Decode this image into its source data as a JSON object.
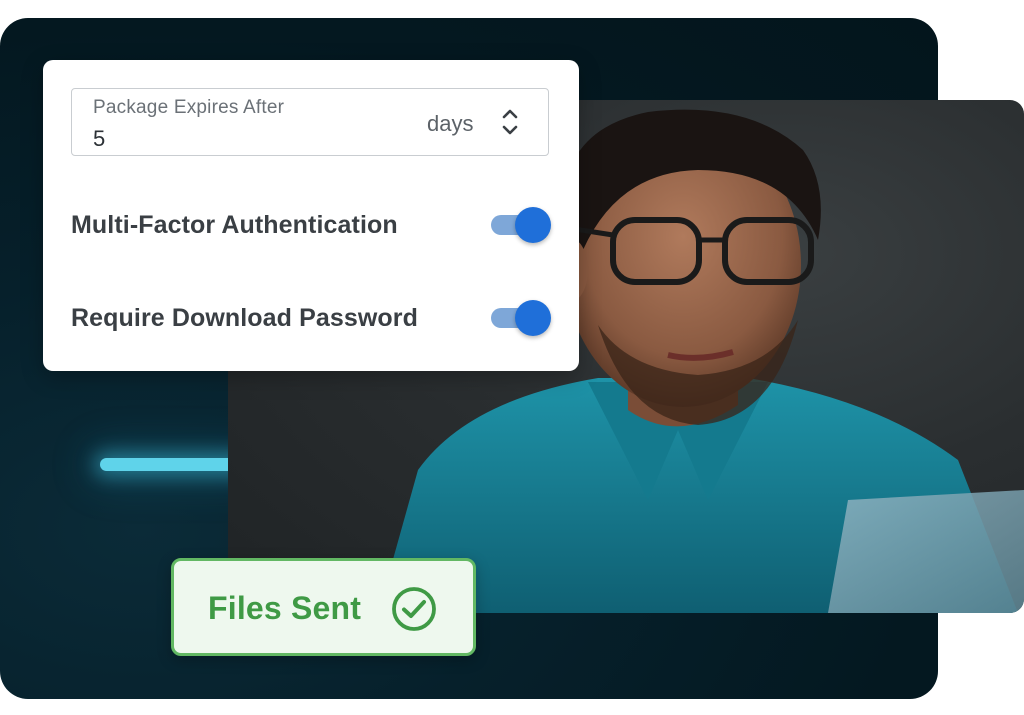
{
  "settings": {
    "expires": {
      "label": "Package Expires After",
      "value": "5",
      "unit": "days"
    },
    "toggles": [
      {
        "label": "Multi-Factor Authentication",
        "enabled": true
      },
      {
        "label": "Require Download Password",
        "enabled": true
      }
    ]
  },
  "status_badge": {
    "text": "Files Sent",
    "icon": "check-circle-icon"
  },
  "colors": {
    "toggle_on": "#1f6fd9",
    "badge_green": "#3f9a45",
    "backdrop": "#041820",
    "glow": "#5fd3ea"
  }
}
